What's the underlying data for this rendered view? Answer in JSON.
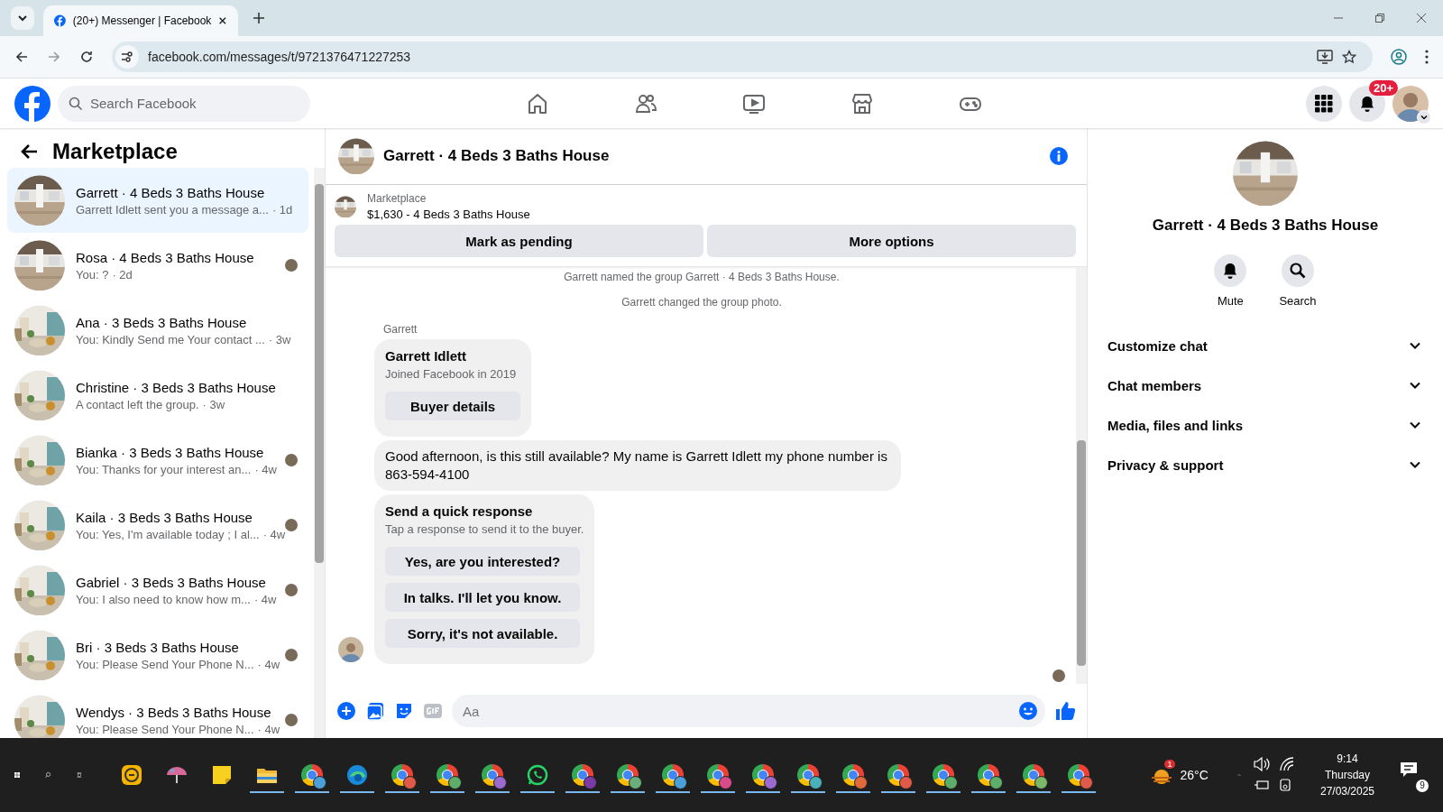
{
  "browser": {
    "tab_title": "(20+) Messenger | Facebook",
    "url": "facebook.com/messages/t/9721376471227253"
  },
  "header": {
    "search_placeholder": "Search Facebook",
    "nav": [
      {
        "kind": "home"
      },
      {
        "kind": "friends"
      },
      {
        "kind": "video"
      },
      {
        "kind": "marketplace"
      },
      {
        "kind": "gaming"
      }
    ],
    "notification_badge": "20+"
  },
  "sidebar": {
    "title": "Marketplace",
    "conversations": [
      {
        "name": "Garrett · 4 Beds 3 Baths House",
        "preview": "Garrett Idlett sent you a message a...",
        "time": "· 1d",
        "selected": true,
        "kind": "empty-room",
        "seen_avatar": false
      },
      {
        "name": "Rosa · 4 Beds 3 Baths House",
        "preview": "You: ?",
        "time": "· 2d",
        "selected": false,
        "kind": "empty-room",
        "seen_avatar": true
      },
      {
        "name": "Ana · 3 Beds 3 Baths House",
        "preview": "You: Kindly Send me Your contact ...",
        "time": "· 3w",
        "selected": false,
        "kind": "furnished-room",
        "seen_avatar": false
      },
      {
        "name": "Christine · 3 Beds 3 Baths House",
        "preview": "A contact left the group.",
        "time": "· 3w",
        "selected": false,
        "kind": "furnished-room",
        "seen_avatar": false
      },
      {
        "name": "Bianka · 3 Beds 3 Baths House",
        "preview": "You: Thanks for your interest an...",
        "time": "· 4w",
        "selected": false,
        "kind": "furnished-room",
        "seen_avatar": true
      },
      {
        "name": "Kaila · 3 Beds 3 Baths House",
        "preview": "You: Yes, I'm available today ; I al...",
        "time": "· 4w",
        "selected": false,
        "kind": "furnished-room",
        "seen_avatar": true
      },
      {
        "name": "Gabriel · 3 Beds 3 Baths House",
        "preview": "You: I also need to know how m...",
        "time": "· 4w",
        "selected": false,
        "kind": "furnished-room",
        "seen_avatar": true
      },
      {
        "name": "Bri · 3 Beds 3 Baths House",
        "preview": "You: Please Send Your Phone N...",
        "time": "· 4w",
        "selected": false,
        "kind": "furnished-room",
        "seen_avatar": true
      },
      {
        "name": "Wendys · 3 Beds 3 Baths House",
        "preview": "You: Please Send Your Phone N...",
        "time": "· 4w",
        "selected": false,
        "kind": "furnished-room",
        "seen_avatar": true
      }
    ]
  },
  "chat": {
    "title": "Garrett · 4 Beds 3 Baths House",
    "listing": {
      "label": "Marketplace",
      "price_title": "$1,630 - 4 Beds 3 Baths House",
      "buttons": [
        "Mark as pending",
        "More options"
      ]
    },
    "events": [
      "Garrett named the group Garrett · 4 Beds 3 Baths House.",
      "Garrett changed the group photo."
    ],
    "sender": "Garrett",
    "buyer_card": {
      "name": "Garrett Idlett",
      "subtitle": "Joined Facebook in 2019",
      "button": "Buyer details"
    },
    "message": "Good afternoon, is this still available? My name is Garrett Idlett my phone number is 863-594-4100",
    "quick_response": {
      "title": "Send a quick response",
      "subtitle": "Tap a response to send it to the buyer.",
      "options": [
        "Yes, are you interested?",
        "In talks. I'll let you know.",
        "Sorry, it's not available."
      ]
    },
    "composer": {
      "placeholder": "Aa"
    }
  },
  "details": {
    "title": "Garrett · 4 Beds 3 Baths House",
    "actions": [
      {
        "kind": "mute",
        "label": "Mute"
      },
      {
        "kind": "search",
        "label": "Search"
      }
    ],
    "sections": [
      {
        "label": "Customize chat",
        "expanded": false
      },
      {
        "label": "Chat members",
        "expanded": false
      },
      {
        "label": "Media, files and links",
        "expanded": false
      },
      {
        "label": "Privacy & support",
        "expanded": false
      }
    ]
  },
  "taskbar": {
    "apps": [
      {
        "kind": "messenger",
        "running": false
      },
      {
        "kind": "snip",
        "running": false
      },
      {
        "kind": "notes",
        "running": false
      },
      {
        "kind": "folder",
        "running": true
      },
      {
        "kind": "chrome",
        "running": true,
        "color": "#4a9fd8"
      },
      {
        "kind": "edge",
        "running": true
      },
      {
        "kind": "chrome",
        "running": true,
        "color": "#e05a4a"
      },
      {
        "kind": "chrome",
        "running": true,
        "color": "#5cae6a"
      },
      {
        "kind": "chrome",
        "running": true,
        "color": "#9a6ad0"
      },
      {
        "kind": "whatsapp",
        "running": true
      },
      {
        "kind": "chrome",
        "running": true,
        "color": "#7a3aa8"
      },
      {
        "kind": "chrome",
        "running": true,
        "color": "#6aae7a"
      },
      {
        "kind": "chrome",
        "running": true,
        "color": "#4a9fd8"
      },
      {
        "kind": "chrome",
        "running": true,
        "color": "#d84a8a"
      },
      {
        "kind": "chrome",
        "running": true,
        "color": "#9a6ad0"
      },
      {
        "kind": "chrome",
        "running": true,
        "color": "#4ab0b8"
      },
      {
        "kind": "chrome",
        "running": true,
        "color": "#e06a3a"
      },
      {
        "kind": "chrome",
        "running": true,
        "color": "#e05a4a"
      },
      {
        "kind": "chrome",
        "running": true,
        "color": "#5cae6a"
      },
      {
        "kind": "chrome",
        "running": true,
        "color": "#5cae6a"
      },
      {
        "kind": "chrome",
        "running": true,
        "color": "#7ab86a"
      },
      {
        "kind": "chrome",
        "running": true,
        "color": "#e05a4a"
      }
    ],
    "weather_alert": "1",
    "temperature": "26°C",
    "time": "9:14",
    "day": "Thursday",
    "date": "27/03/2025",
    "notifications": "9"
  }
}
